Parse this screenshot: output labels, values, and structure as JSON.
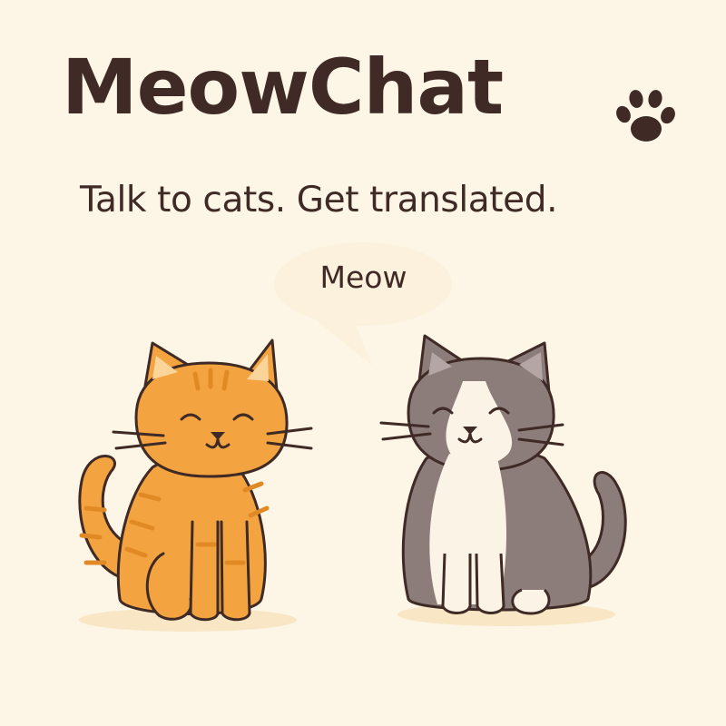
{
  "brand": {
    "name": "MeowChat",
    "icon": "paw-print-icon",
    "tagline": "Talk to cats. Get translated."
  },
  "speech_bubble": {
    "text": "Meow"
  },
  "illustration": {
    "cats": [
      {
        "name": "orange-tabby-cat",
        "color": "#f3a440"
      },
      {
        "name": "gray-white-cat",
        "color": "#8c7d7b"
      }
    ]
  },
  "colors": {
    "background": "#fdf6e6",
    "text": "#3f2a25",
    "bubble": "#fbf1dc"
  }
}
